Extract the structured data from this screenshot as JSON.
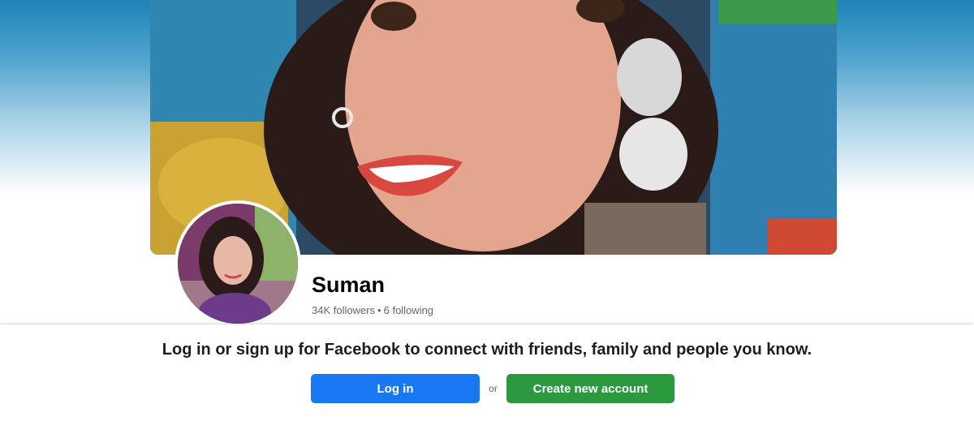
{
  "profile": {
    "name": "Suman",
    "followers": "34K followers",
    "separator": "•",
    "following": "6 following"
  },
  "login_banner": {
    "prompt": "Log in or sign up for Facebook to connect with friends, family and people you know.",
    "login_label": "Log in",
    "or_label": "or",
    "create_label": "Create new account"
  },
  "colors": {
    "login_button": "#1877f2",
    "create_button": "#2b9a3f",
    "background_top": "#1f84b7"
  }
}
